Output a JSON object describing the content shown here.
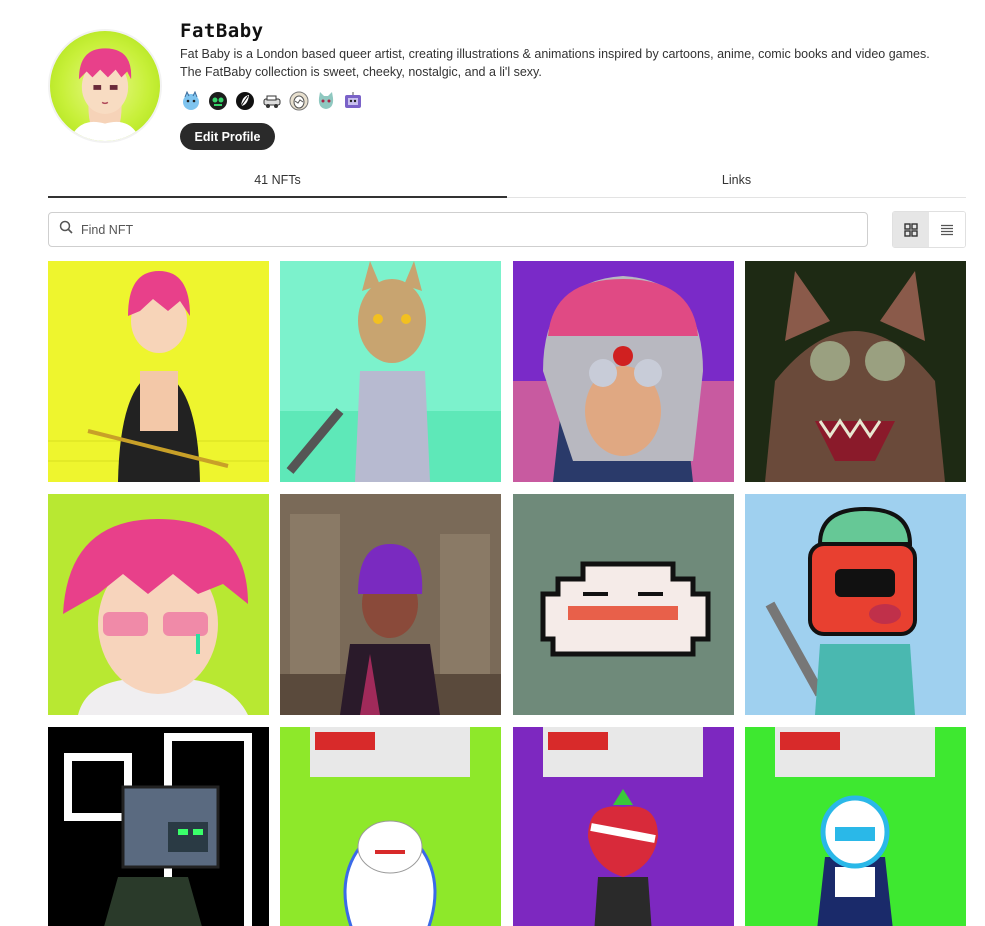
{
  "profile": {
    "name": "FatBaby",
    "bio_line1": "Fat Baby is a London based queer artist, creating illustrations & animations inspired by cartoons, anime, comic books and video games.",
    "bio_line2": "The FatBaby collection is sweet, cheeky, nostalgic, and a li'l sexy.",
    "edit_label": "Edit Profile",
    "badges": [
      "cat-badge-icon",
      "robot-badge-icon",
      "leaf-badge-icon",
      "car-badge-icon",
      "egg-badge-icon",
      "cat-face-badge-icon",
      "tv-robot-badge-icon"
    ]
  },
  "tabs": [
    {
      "label": "41 NFTs",
      "active": true
    },
    {
      "label": "Links",
      "active": false
    }
  ],
  "search": {
    "placeholder": "Find NFT",
    "value": ""
  },
  "view": {
    "active": "grid"
  },
  "nfts": [
    {
      "bg": "#e9f42a"
    },
    {
      "bg": "#6ef0c8"
    },
    {
      "bg": "#7a2ac8"
    },
    {
      "bg": "#1e2a14"
    },
    {
      "bg": "#b8e832"
    },
    {
      "bg": "#6b5a48"
    },
    {
      "bg": "#6f8a7a"
    },
    {
      "bg": "#9fd0ef"
    },
    {
      "bg": "#000000"
    },
    {
      "bg": "#8ee82a"
    },
    {
      "bg": "#7d28c0"
    },
    {
      "bg": "#3ee830"
    }
  ],
  "colors": {
    "accent": "#2a2a2a",
    "hair_pink": "#e8408a"
  }
}
